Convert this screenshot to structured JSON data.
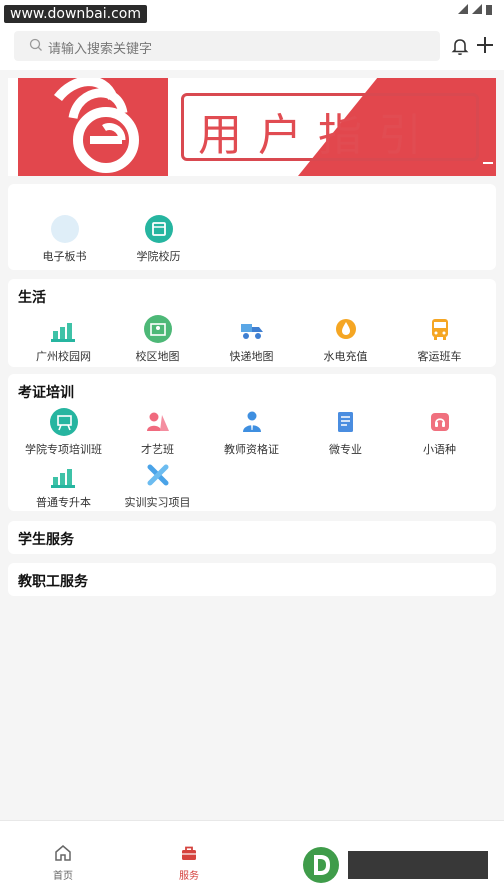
{
  "status_bar": {
    "watermark": "www.downbai.com"
  },
  "search": {
    "placeholder": "请输入搜索关键字"
  },
  "banner": {
    "title": "用户指引"
  },
  "quick_links": [
    {
      "label": "电子板书",
      "icon": "ebook-icon"
    },
    {
      "label": "学院校历",
      "icon": "calendar-icon"
    }
  ],
  "life": {
    "title": "生活",
    "items": [
      {
        "label": "广州校园网",
        "icon": "campus-net-icon"
      },
      {
        "label": "校区地图",
        "icon": "map-icon"
      },
      {
        "label": "快递地图",
        "icon": "delivery-icon"
      },
      {
        "label": "水电充值",
        "icon": "utility-recharge-icon"
      },
      {
        "label": "客运班车",
        "icon": "bus-icon"
      }
    ]
  },
  "exam": {
    "title": "考证培训",
    "items": [
      {
        "label": "学院专项培训班",
        "icon": "training-icon"
      },
      {
        "label": "才艺班",
        "icon": "arts-icon"
      },
      {
        "label": "教师资格证",
        "icon": "teacher-cert-icon"
      },
      {
        "label": "微专业",
        "icon": "micro-major-icon"
      },
      {
        "label": "小语种",
        "icon": "language-icon"
      },
      {
        "label": "普通专升本",
        "icon": "upgrade-icon"
      },
      {
        "label": "实训实习项目",
        "icon": "practice-icon"
      }
    ]
  },
  "sections": {
    "student": "学生服务",
    "staff": "教职工服务"
  },
  "nav": {
    "home": "首页",
    "service": "服务"
  },
  "colors": {
    "accent": "#d5433e",
    "teal": "#26b5a0",
    "green": "#4db877"
  }
}
